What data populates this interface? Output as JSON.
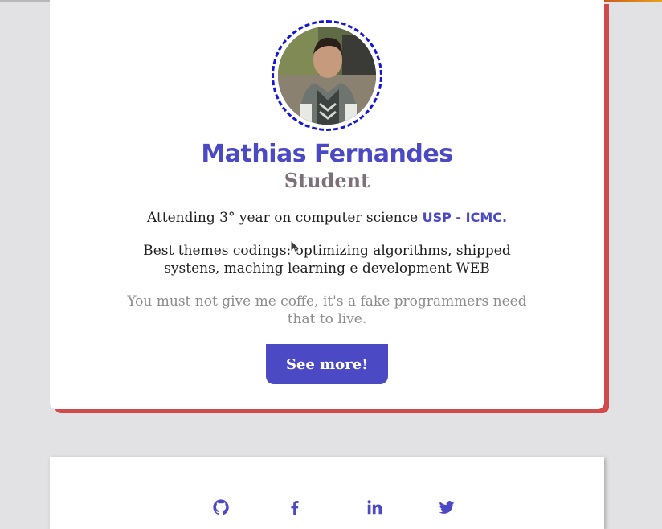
{
  "profile": {
    "name": "Mathias Fernandes",
    "role": "Student",
    "attending_prefix": "Attending 3° year on computer science ",
    "university_link": "USP - ICMC.",
    "themes": "Best themes codings: optimizing algorithms, shipped systens, maching learning e development WEB",
    "quote": "You must not give me coffe, it's a fake programmers need that to live.",
    "see_more_label": "See more!"
  },
  "colors": {
    "accent": "#4b49c4",
    "card_shadow": "#d24b4b",
    "avatar_ring": "#1515d6",
    "role_text": "#7d7179",
    "quote_text": "#8c8c8c",
    "page_background": "#e2e2e4"
  },
  "social": {
    "icons": [
      "github-icon",
      "facebook-icon",
      "linkedin-icon",
      "twitter-icon"
    ]
  }
}
